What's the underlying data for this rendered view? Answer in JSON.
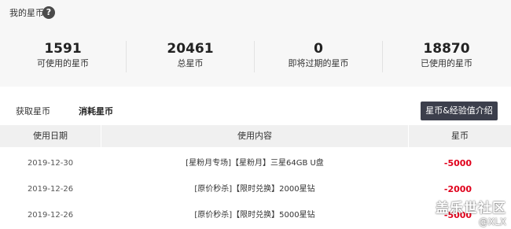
{
  "summary": {
    "title": "我的星币",
    "help_icon": "?",
    "stats": [
      {
        "value": "1591",
        "label": "可使用的星币"
      },
      {
        "value": "20461",
        "label": "总星币"
      },
      {
        "value": "0",
        "label": "即将过期的星币"
      },
      {
        "value": "18870",
        "label": "已使用的星币"
      }
    ]
  },
  "tabs": [
    {
      "label": "获取星币",
      "active": false
    },
    {
      "label": "消耗星币",
      "active": true
    }
  ],
  "intro_button": "星币&经验值介绍",
  "table": {
    "headers": [
      "使用日期",
      "使用内容",
      "星币"
    ],
    "rows": [
      {
        "date": "2019-12-30",
        "content": "[星粉月专场]【星粉月】三星64GB U盘",
        "coins": "-5000"
      },
      {
        "date": "2019-12-26",
        "content": "[原价秒杀]【限时兑换】2000星钻",
        "coins": "-2000"
      },
      {
        "date": "2019-12-26",
        "content": "[原价秒杀]【限时兑换】5000星钻",
        "coins": "-5000"
      }
    ]
  },
  "watermark": {
    "main": "盖乐世社区",
    "sub": "@XLX"
  },
  "colors": {
    "accent_button": "#3c3f4c",
    "negative_coins": "#e0001b",
    "panel_bg": "#f7f7f7"
  }
}
